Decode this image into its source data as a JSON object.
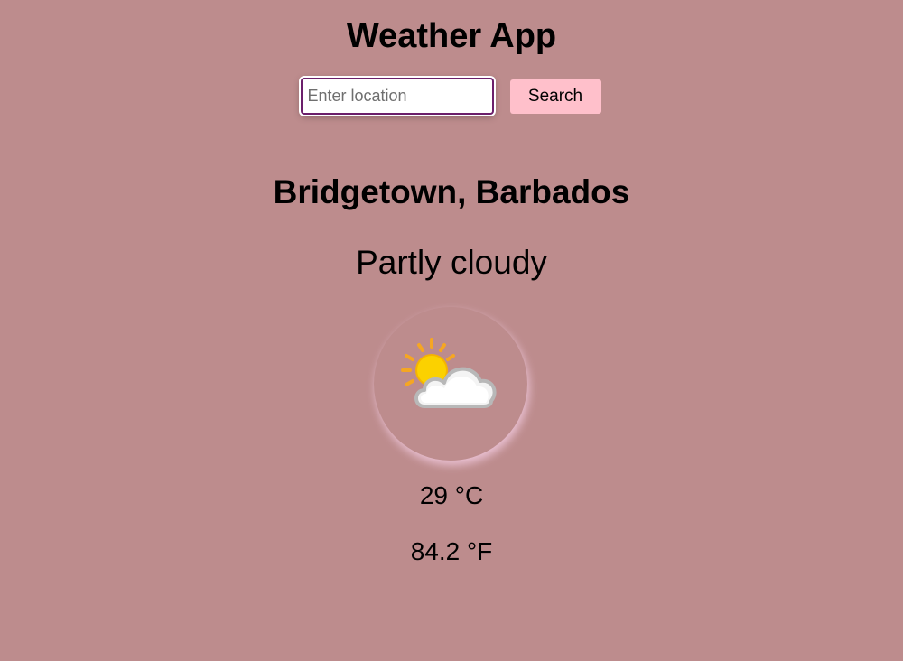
{
  "app": {
    "title": "Weather App"
  },
  "search": {
    "placeholder": "Enter location",
    "value": "",
    "button_label": "Search"
  },
  "weather": {
    "location": "Bridgetown, Barbados",
    "condition": "Partly cloudy",
    "icon": "partly-cloudy-icon",
    "temp_c": "29 °C",
    "temp_f": "84.2 °F"
  },
  "colors": {
    "background": "#bd8c8d",
    "button": "#ffc0cb",
    "input_border": "#6b1f6b"
  }
}
